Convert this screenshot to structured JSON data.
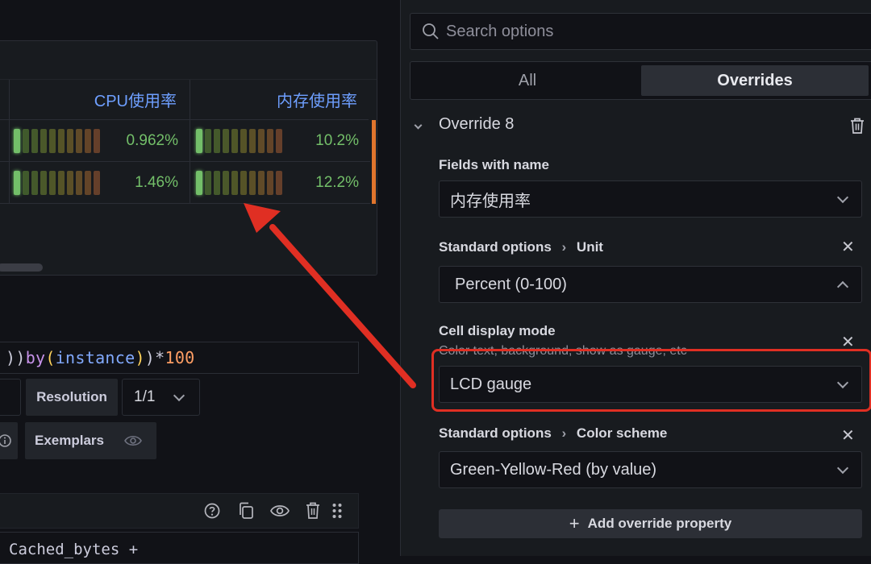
{
  "table": {
    "headers": [
      "CPU使用率",
      "内存使用率"
    ],
    "rows": [
      {
        "cpu": "0.962%",
        "cpu_level": 0.1,
        "mem": "10.2%",
        "mem_level": 0.1
      },
      {
        "cpu": "1.46%",
        "cpu_level": 0.1,
        "mem": "12.2%",
        "mem_level": 0.1
      }
    ]
  },
  "query": {
    "line1": [
      "))",
      " by",
      " (",
      "instance",
      ")",
      " )",
      " *",
      " 100"
    ],
    "line2": "Cached_bytes +"
  },
  "controls": {
    "resolution_label": "Resolution",
    "resolution_value": "1/1",
    "exemplars_label": "Exemplars"
  },
  "options": {
    "search_placeholder": "Search options",
    "tab_all": "All",
    "tab_overrides": "Overrides",
    "override_title": "Override 8",
    "fields_with_name_label": "Fields with name",
    "fields_with_name_value": "内存使用率",
    "unit_prefix": "Standard options",
    "unit_label": "Unit",
    "unit_value": "Percent (0-100)",
    "cell_display_label": "Cell display mode",
    "cell_display_desc": "Color text, background, show as gauge, etc",
    "cell_display_value": "LCD gauge",
    "color_prefix": "Standard options",
    "color_label": "Color scheme",
    "color_value": "Green-Yellow-Red (by value)",
    "add_override": "Add override property"
  },
  "colors": {
    "accent_link": "#6e9fff",
    "value_green": "#73bf69",
    "highlight_red": "#e02f23",
    "row_marker": "#e0752d"
  }
}
